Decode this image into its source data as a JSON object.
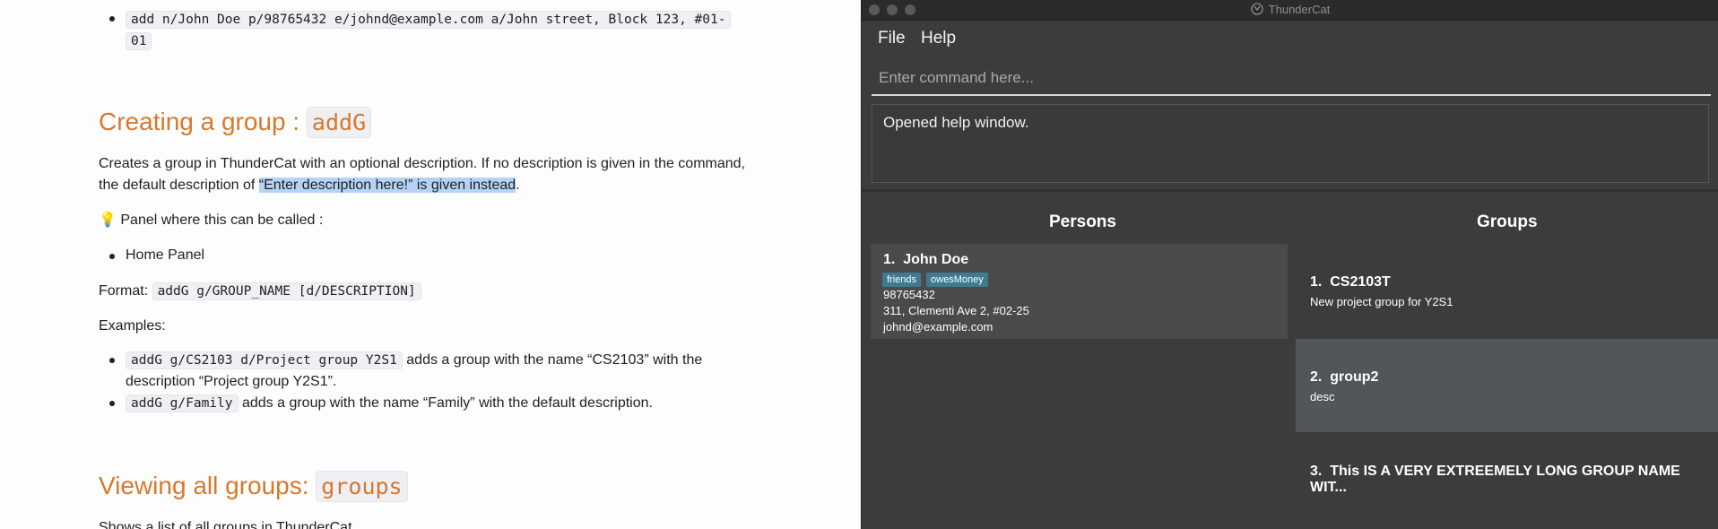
{
  "doc": {
    "example_top": "add n/John Doe p/98765432 e/johnd@example.com a/John street, Block 123, #01-",
    "example_top_wrap": "01",
    "addG_heading": "Creating a group :",
    "addG_code": "addG",
    "addG_desc_1": "Creates a group in ThunderCat with an optional description. If no description is given in the command,",
    "addG_desc_2_pre": "the default description of ",
    "addG_desc_2_sel": "“Enter description here!” is given instead",
    "addG_desc_2_post": ".",
    "panel_tip": "💡 Panel where this can be called :",
    "panel_item": "Home Panel",
    "format_label": "Format:",
    "format_code": "addG g/GROUP_NAME [d/DESCRIPTION]",
    "examples_label": "Examples:",
    "ex1_code": "addG g/CS2103 d/Project group Y2S1",
    "ex1_text": "adds a group with the name “CS2103” with the",
    "ex1_text2": "description “Project group Y2S1”.",
    "ex2_code": "addG g/Family",
    "ex2_text": "adds a group with the name “Family” with the default description.",
    "groups_heading": "Viewing all groups:",
    "groups_code": "groups",
    "groups_desc": "Shows a list of all groups in ThunderCat."
  },
  "app": {
    "title": "ThunderCat",
    "menu": {
      "file": "File",
      "help": "Help"
    },
    "command_placeholder": "Enter command here...",
    "result": "Opened help window.",
    "persons_title": "Persons",
    "groups_title": "Groups",
    "persons": [
      {
        "index": "1.",
        "name": "John Doe",
        "tags": [
          "friends",
          "owesMoney"
        ],
        "phone": "98765432",
        "address": "311, Clementi Ave 2, #02-25",
        "email": "johnd@example.com"
      }
    ],
    "groups": [
      {
        "index": "1.",
        "name": "CS2103T",
        "desc": "New project group for Y2S1",
        "bg": "#3c3c3c"
      },
      {
        "index": "2.",
        "name": "group2",
        "desc": "desc",
        "bg": "#515658"
      },
      {
        "index": "3.",
        "name": "This IS A VERY EXTREEMELY LONG GROUP NAME WIT...",
        "desc": "",
        "bg": "#3c3c3c"
      }
    ]
  },
  "colors": {
    "accent_heading": "#d9772b",
    "tag": "#3e7b91",
    "selected_text": "#b5d3f7"
  }
}
